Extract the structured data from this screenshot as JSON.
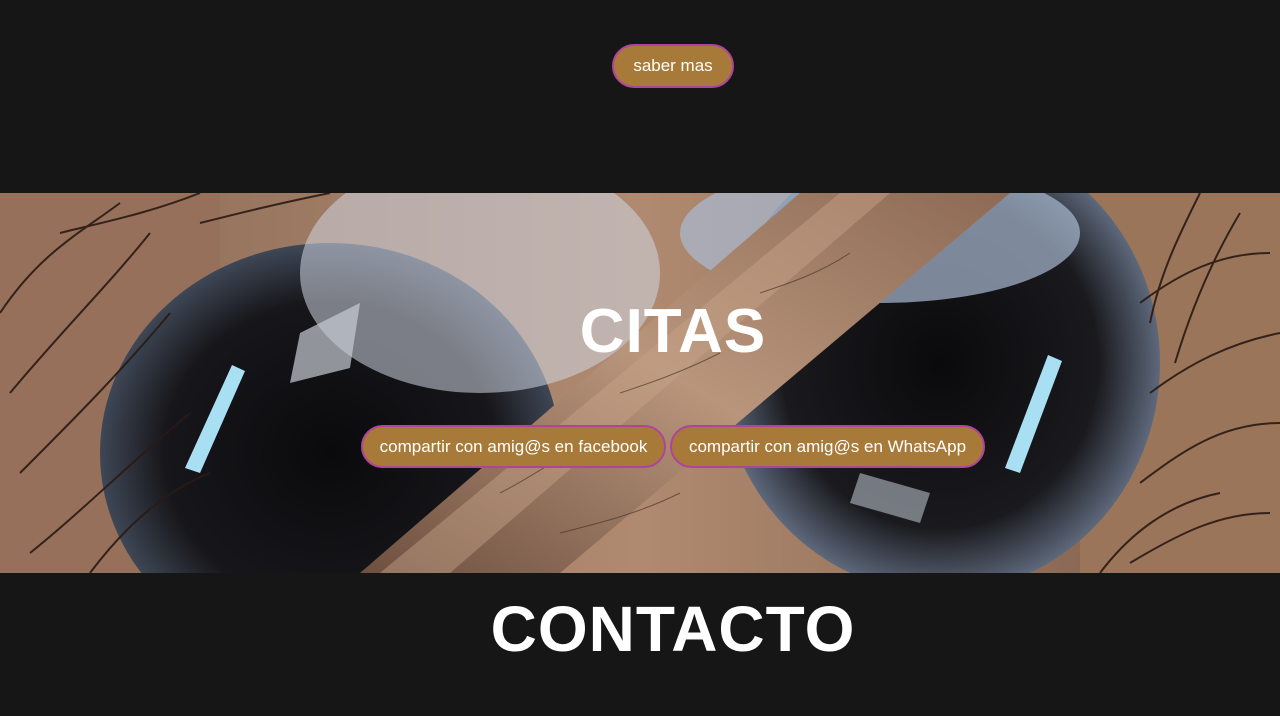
{
  "top": {
    "saber_label": "saber mas"
  },
  "hero": {
    "title": "CITAS",
    "share_facebook_label": "compartir con amig@s en facebook",
    "share_whatsapp_label": "compartir con amig@s en WhatsApp"
  },
  "contact": {
    "title": "CONTACTO"
  },
  "colors": {
    "background": "#161616",
    "button_fill": "#a87a3a",
    "button_border": "#b0439c",
    "text": "#ffffff"
  },
  "icons": {
    "hero_image": "eyes-closeup-image"
  }
}
